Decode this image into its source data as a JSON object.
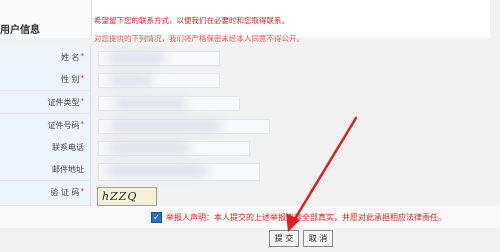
{
  "header": {
    "title": "用户信息",
    "notice_line1": "希望留下您的联系方式，以便我们在必要时和您取得联系。",
    "notice_line2": "对您提供的下列情况，我们将严格保密未经本人同意不得公开。"
  },
  "form": {
    "rows": [
      {
        "label": "姓 名",
        "required": true
      },
      {
        "label": "性 别",
        "required": true
      },
      {
        "label": "证件类型",
        "required": true
      },
      {
        "label": "证件号码",
        "required": true
      },
      {
        "label": "联系电话",
        "required": false
      },
      {
        "label": "邮件地址",
        "required": false
      },
      {
        "label": "验 证 码",
        "required": true
      }
    ],
    "required_mark": "*",
    "captcha_text": "hZZQ"
  },
  "declaration": {
    "checked": true,
    "text": "举报人声明：本人提交的上述举报内容全部真实，并愿对此承担相应法律责任。"
  },
  "actions": {
    "submit_label": "提 交",
    "cancel_label": "取 消"
  },
  "overlay": {
    "arrow_color": "#e02020"
  }
}
